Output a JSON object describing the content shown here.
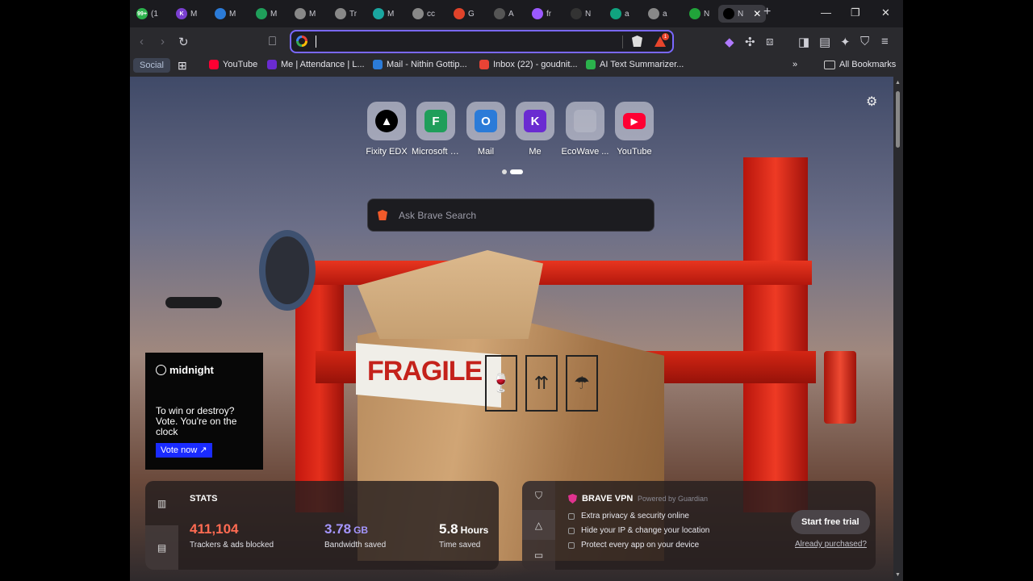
{
  "tabs": [
    {
      "label": "(1",
      "fav_color": "#2bb24c",
      "fav_text": "99+"
    },
    {
      "label": "M",
      "fav_color": "#7a3fd0",
      "fav_text": "K"
    },
    {
      "label": "M",
      "fav_color": "#2b7bd8",
      "fav_text": ""
    },
    {
      "label": "M",
      "fav_color": "#1f9e5a",
      "fav_text": ""
    },
    {
      "label": "M",
      "fav_color": "#888888",
      "fav_text": ""
    },
    {
      "label": "Tr",
      "fav_color": "#888888",
      "fav_text": ""
    },
    {
      "label": "M",
      "fav_color": "#1aa6a0",
      "fav_text": ""
    },
    {
      "label": "cc",
      "fav_color": "#888888",
      "fav_text": ""
    },
    {
      "label": "G",
      "fav_color": "#e0432a",
      "fav_text": ""
    },
    {
      "label": "A",
      "fav_color": "#555555",
      "fav_text": ""
    },
    {
      "label": "fr",
      "fav_color": "#9b59ff",
      "fav_text": ""
    },
    {
      "label": "N",
      "fav_color": "#333333",
      "fav_text": ""
    },
    {
      "label": "a",
      "fav_color": "#10a37f",
      "fav_text": ""
    },
    {
      "label": "a",
      "fav_color": "#888888",
      "fav_text": ""
    },
    {
      "label": "N",
      "fav_color": "#21a33a",
      "fav_text": ""
    },
    {
      "label": "N",
      "fav_color": "#000000",
      "fav_text": ""
    }
  ],
  "address_bar": {
    "value": "",
    "placeholder": ""
  },
  "vpn_badge": "1",
  "bookmarks": {
    "folder": "Social",
    "items": [
      {
        "label": "YouTube",
        "color": "#ff0033"
      },
      {
        "label": "Me | Attendance | L...",
        "color": "#6a2bd1"
      },
      {
        "label": "Mail - Nithin Gottip...",
        "color": "#2b7bd8"
      },
      {
        "label": "Inbox (22) - goudnit...",
        "color": "#ea4335"
      },
      {
        "label": "AI Text Summarizer...",
        "color": "#2bb24c"
      }
    ],
    "all_label": "All Bookmarks"
  },
  "top_sites": [
    {
      "label": "Fixity EDX",
      "icon": "triangle",
      "bg": "#000000",
      "fg": "#ffffff"
    },
    {
      "label": "Microsoft F...",
      "icon": "F",
      "bg": "#1f9e5a",
      "fg": "#ffffff"
    },
    {
      "label": "Mail",
      "icon": "O",
      "bg": "#2b7bd8",
      "fg": "#ffffff"
    },
    {
      "label": "Me",
      "icon": "K",
      "bg": "#6a2bd1",
      "fg": "#ffffff"
    },
    {
      "label": "EcoWave ...",
      "icon": "",
      "bg": "#b8b8c0",
      "fg": "#ffffff"
    },
    {
      "label": "YouTube",
      "icon": "play",
      "bg": "#ff0033",
      "fg": "#ffffff"
    }
  ],
  "search": {
    "placeholder": "Ask Brave Search"
  },
  "promo": {
    "brand": "midnight",
    "text": "To win or destroy? Vote. You're on the clock",
    "button": "Vote now ↗"
  },
  "stats": {
    "title": "STATS",
    "trackers": {
      "value": "411,104",
      "caption": "Trackers & ads blocked",
      "color": "#ff6b52"
    },
    "bandwidth": {
      "value": "3.78",
      "unit": "GB",
      "caption": "Bandwidth saved",
      "color": "#a596ff"
    },
    "time": {
      "value": "5.8",
      "unit": "Hours",
      "caption": "Time saved",
      "color": "#ffffff"
    }
  },
  "vpn": {
    "title": "BRAVE VPN",
    "powered": "Powered by  Guardian",
    "features": [
      "Extra privacy & security online",
      "Hide your IP & change your location",
      "Protect every app on your device"
    ],
    "cta": "Start free trial",
    "already": "Already purchased?"
  },
  "background_text": "FRAGILE"
}
